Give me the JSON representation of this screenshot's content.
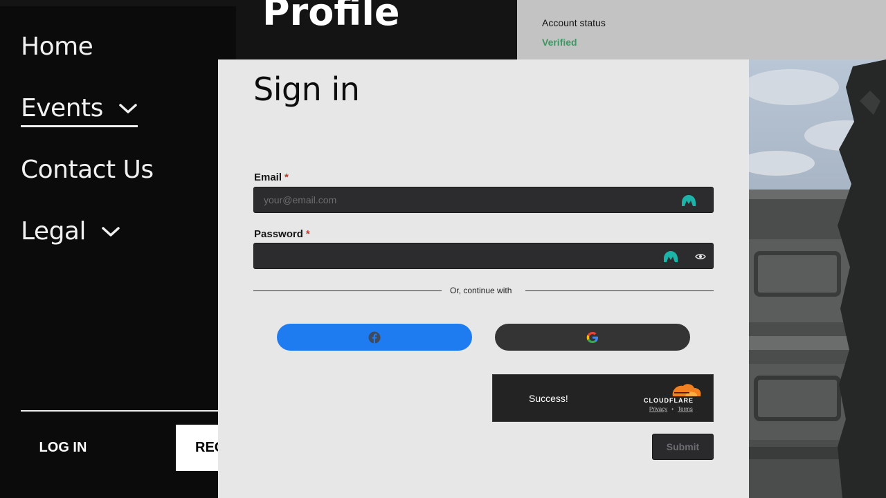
{
  "nav": {
    "items": [
      {
        "label": "Home",
        "has_dropdown": false
      },
      {
        "label": "Events",
        "has_dropdown": true,
        "active": true
      },
      {
        "label": "Contact Us",
        "has_dropdown": false
      },
      {
        "label": "Legal",
        "has_dropdown": true
      }
    ],
    "login_label": "LOG IN",
    "register_label": "REG"
  },
  "profile": {
    "title": "Profile",
    "account_status_label": "Account status",
    "account_status_value": "Verified"
  },
  "signin": {
    "title": "Sign in",
    "email_label": "Email",
    "email_placeholder": "your@email.com",
    "password_label": "Password",
    "required_marker": "*",
    "divider_text": "Or, continue with",
    "social": [
      "facebook-icon",
      "google-icon"
    ],
    "captcha": {
      "status": "Success!",
      "brand": "CLOUDFLARE",
      "privacy": "Privacy",
      "separator": "•",
      "terms": "Terms"
    },
    "submit_label": "Submit"
  },
  "colors": {
    "accent_facebook": "#1f7cf0",
    "verified_green": "#3a9a63",
    "required_red": "#d0342c",
    "cloudflare_orange": "#f38020"
  }
}
